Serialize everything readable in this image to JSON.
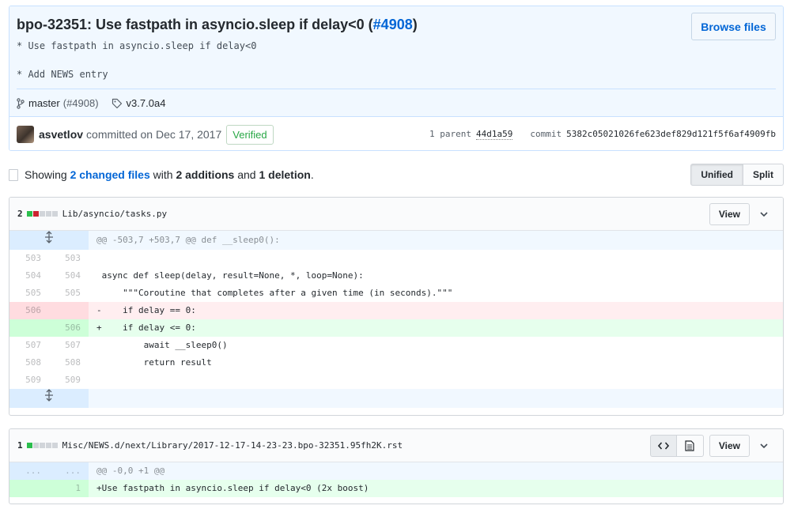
{
  "commit": {
    "title": "bpo-32351: Use fastpath in asyncio.sleep if delay<0 (",
    "issue_ref": "#4908",
    "title_close": ")",
    "description": "* Use fastpath in asyncio.sleep if delay<0\n\n* Add NEWS entry",
    "browse_files_label": "Browse files",
    "branch": "master",
    "branch_pr": "(#4908)",
    "tag": "v3.7.0a4",
    "author": "asvetlov",
    "committed_text": "committed on Dec 17, 2017",
    "verified_label": "Verified",
    "parent_label": "1 parent",
    "parent_sha": "44d1a59",
    "commit_label": "commit",
    "commit_sha": "5382c05021026fe623def829d121f5f6af4909fb"
  },
  "toc": {
    "showing": "Showing ",
    "changed_files": "2 changed files",
    "with": " with ",
    "additions": "2 additions",
    "and": " and ",
    "deletions": "1 deletion",
    "period": ".",
    "unified_label": "Unified",
    "split_label": "Split"
  },
  "files": [
    {
      "count": "2",
      "name": "Lib/asyncio/tasks.py",
      "view_label": "View",
      "hunk": "@@ -503,7 +503,7 @@ def __sleep0():",
      "blocks": [
        "add",
        "del",
        "neu",
        "neu",
        "neu"
      ],
      "lines": [
        {
          "old": "503",
          "new": "503",
          "type": "ctx",
          "text": ""
        },
        {
          "old": "504",
          "new": "504",
          "type": "ctx",
          "text": " async def sleep(delay, result=None, *, loop=None):"
        },
        {
          "old": "505",
          "new": "505",
          "type": "ctx",
          "text": "     \"\"\"Coroutine that completes after a given time (in seconds).\"\"\""
        },
        {
          "old": "506",
          "new": "",
          "type": "del",
          "text": "-    if delay == 0:"
        },
        {
          "old": "",
          "new": "506",
          "type": "add",
          "text": "+    if delay <= 0:"
        },
        {
          "old": "507",
          "new": "507",
          "type": "ctx",
          "text": "         await __sleep0()"
        },
        {
          "old": "508",
          "new": "508",
          "type": "ctx",
          "text": "         return result"
        },
        {
          "old": "509",
          "new": "509",
          "type": "ctx",
          "text": ""
        }
      ]
    },
    {
      "count": "1",
      "name": "Misc/NEWS.d/next/Library/2017-12-17-14-23-23.bpo-32351.95fh2K.rst",
      "view_label": "View",
      "hunk": "@@ -0,0 +1 @@",
      "hunk_old": "...",
      "hunk_new": "...",
      "blocks": [
        "add",
        "neu",
        "neu",
        "neu",
        "neu"
      ],
      "lines": [
        {
          "old": "",
          "new": "1",
          "type": "add",
          "text": "+Use fastpath in asyncio.sleep if delay<0 (2x boost)"
        }
      ]
    }
  ]
}
